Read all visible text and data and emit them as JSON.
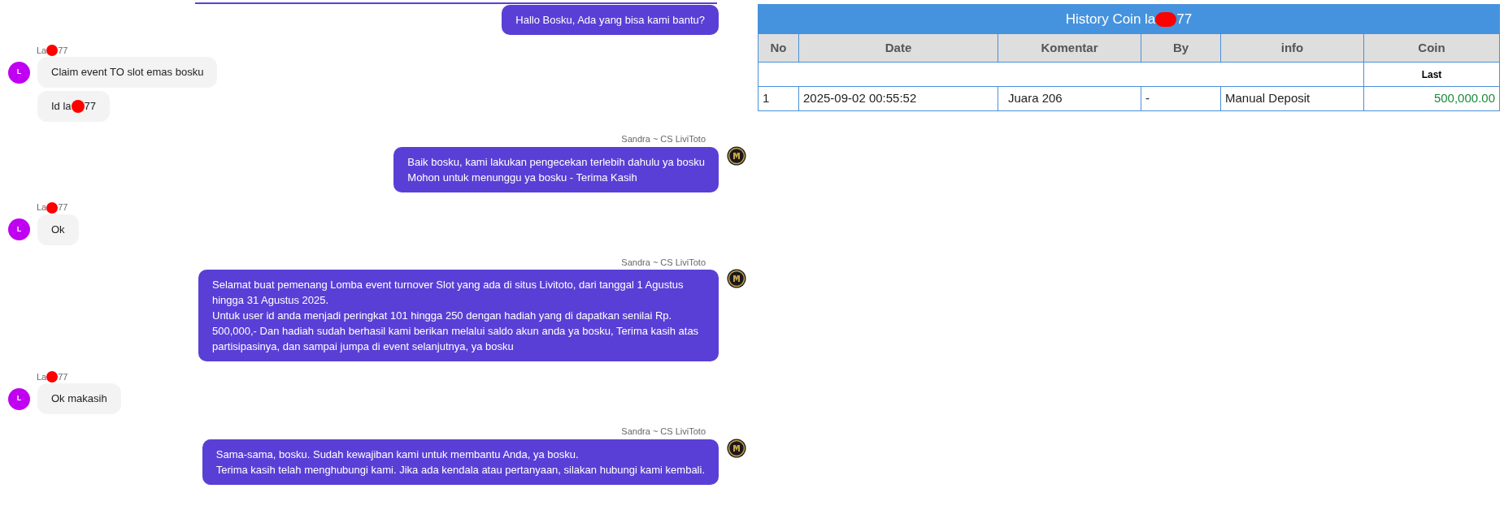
{
  "chat": {
    "messages": [
      {
        "kind": "agent",
        "lines": [
          "Hallo Bosku, Ada yang bisa kami bantu?"
        ]
      },
      {
        "kind": "customer",
        "sender": [
          "La",
          "77"
        ],
        "avatar": "L",
        "bubbles": [
          [
            "Claim event TO slot emas bosku"
          ],
          [
            "Id la",
            "77"
          ]
        ]
      },
      {
        "kind": "agent",
        "sender": "Sandra ~ CS LiviToto",
        "lines": [
          "Baik bosku, kami lakukan pengecekan terlebih dahulu ya bosku",
          "Mohon untuk menunggu ya bosku - Terima Kasih"
        ]
      },
      {
        "kind": "customer",
        "sender": [
          "La",
          "77"
        ],
        "avatar": "L",
        "bubbles": [
          [
            "Ok"
          ]
        ]
      },
      {
        "kind": "agent",
        "sender": "Sandra ~ CS LiviToto",
        "lines": [
          "Selamat buat pemenang Lomba event turnover Slot yang ada di situs Livitoto, dari tanggal 1 Agustus hingga 31 Agustus 2025.",
          "Untuk user id anda menjadi peringkat 101 hingga 250 dengan hadiah yang di dapatkan senilai Rp. 500,000,- Dan hadiah sudah berhasil kami berikan melalui saldo akun anda ya bosku, Terima kasih atas partisipasinya, dan sampai jumpa di event selanjutnya, ya bosku"
        ]
      },
      {
        "kind": "customer",
        "sender": [
          "La",
          "77"
        ],
        "avatar": "L",
        "bubbles": [
          [
            "Ok makasih"
          ]
        ]
      },
      {
        "kind": "agent",
        "sender": "Sandra ~ CS LiviToto",
        "lines": [
          "Sama-sama, bosku. Sudah kewajiban kami untuk membantu Anda, ya bosku.",
          "Terima kasih telah menghubungi kami. Jika ada kendala atau pertanyaan, silakan hubungi kami kembali."
        ]
      }
    ]
  },
  "history_table": {
    "title": [
      "History Coin la",
      "77"
    ],
    "columns": [
      "No",
      "Date",
      "Komentar",
      "By",
      "info",
      "Coin"
    ],
    "subheader": "Last",
    "rows": [
      {
        "cells": [
          "1",
          "2025-09-02 00:55:52",
          "Juara 206",
          "-",
          "Manual Deposit",
          "500,000.00"
        ]
      }
    ]
  }
}
